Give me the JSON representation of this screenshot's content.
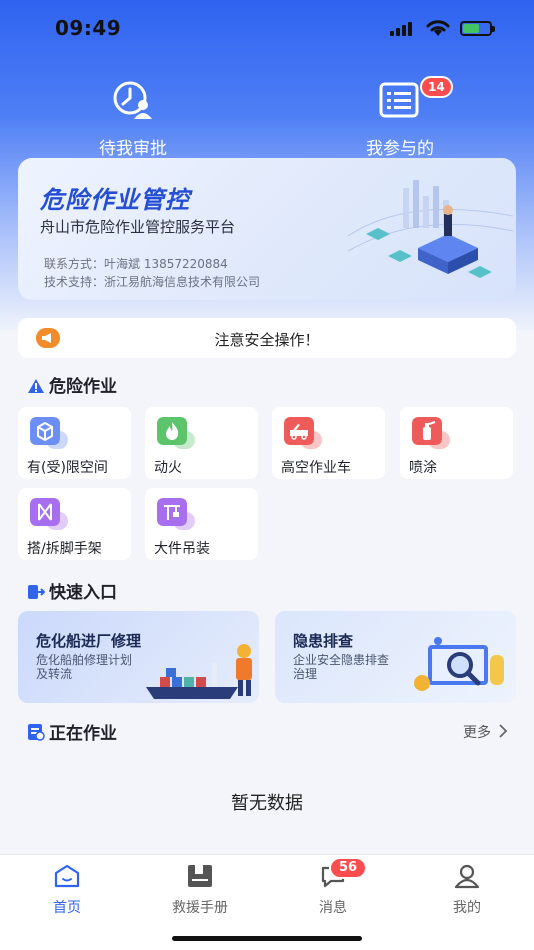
{
  "status_bar": {
    "time": "09:49"
  },
  "top_actions": [
    {
      "label": "待我审批"
    },
    {
      "label": "我参与的",
      "badge": "14"
    }
  ],
  "banner": {
    "title": "危险作业管控",
    "subtitle": "舟山市危险作业管控服务平台",
    "contact": "联系方式：叶海斌 13857220884",
    "tech": "技术支持：浙江易航海信息技术有限公司"
  },
  "notice": {
    "text": "注意安全操作！"
  },
  "danger_section": {
    "title": "危险作业",
    "items": [
      {
        "label": "有(受)限空间",
        "color": "#6b8ff5"
      },
      {
        "label": "动火",
        "color": "#5cc46a"
      },
      {
        "label": "高空作业车",
        "color": "#ef5a5a"
      },
      {
        "label": "喷涂",
        "color": "#ef5a5a"
      },
      {
        "label": "搭/拆脚手架",
        "color": "#a86ef0"
      },
      {
        "label": "大件吊装",
        "color": "#a86ef0"
      }
    ]
  },
  "quick_section": {
    "title": "快速入口",
    "items": [
      {
        "title": "危化船进厂修理",
        "desc1": "危化船舶修理计划",
        "desc2": "及转流"
      },
      {
        "title": "隐患排查",
        "desc1": "企业安全隐患排查",
        "desc2": "治理"
      }
    ]
  },
  "working_section": {
    "title": "正在作业",
    "more": "更多",
    "empty": "暂无数据"
  },
  "tabbar": {
    "tabs": [
      {
        "label": "首页",
        "active": true
      },
      {
        "label": "救援手册"
      },
      {
        "label": "消息",
        "badge": "56"
      },
      {
        "label": "我的"
      }
    ]
  },
  "colors": {
    "primary": "#2f63f0",
    "badge": "#ff4d4f",
    "notice": "#f28b2c"
  }
}
